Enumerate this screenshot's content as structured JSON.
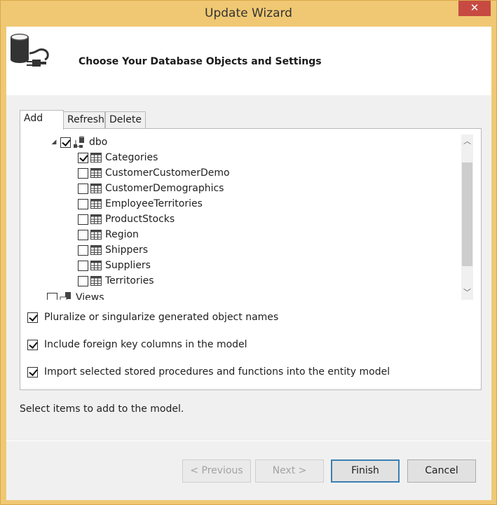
{
  "window": {
    "title": "Update Wizard",
    "close_glyph": "✕"
  },
  "header": {
    "title": "Choose Your Database Objects and Settings",
    "icon": "database-connection-icon"
  },
  "tabs": [
    {
      "label": "Add",
      "active": true
    },
    {
      "label": "Refresh",
      "active": false
    },
    {
      "label": "Delete",
      "active": false
    }
  ],
  "tree": {
    "schema": {
      "label": "dbo",
      "checked": true,
      "expanded": true,
      "expander_glyph": "◢"
    },
    "tables": [
      {
        "label": "Categories",
        "checked": true
      },
      {
        "label": "CustomerCustomerDemo",
        "checked": false
      },
      {
        "label": "CustomerDemographics",
        "checked": false
      },
      {
        "label": "EmployeeTerritories",
        "checked": false
      },
      {
        "label": "ProductStocks",
        "checked": false
      },
      {
        "label": "Region",
        "checked": false
      },
      {
        "label": "Shippers",
        "checked": false
      },
      {
        "label": "Suppliers",
        "checked": false
      },
      {
        "label": "Territories",
        "checked": false
      }
    ],
    "views": {
      "label": "Views",
      "checked": false
    }
  },
  "scrollbar": {
    "up_glyph": "︿",
    "down_glyph": "﹀"
  },
  "options": [
    {
      "label": "Pluralize or singularize generated object names",
      "checked": true
    },
    {
      "label": "Include foreign key columns in the model",
      "checked": true
    },
    {
      "label": "Import selected stored procedures and functions into the entity model",
      "checked": true
    }
  ],
  "status_text": "Select items to add to the model.",
  "buttons": {
    "previous": "< Previous",
    "next": "Next >",
    "finish": "Finish",
    "cancel": "Cancel"
  },
  "colors": {
    "frame": "#f0c873",
    "close": "#c74a42",
    "default_button_border": "#3c7fb1"
  }
}
